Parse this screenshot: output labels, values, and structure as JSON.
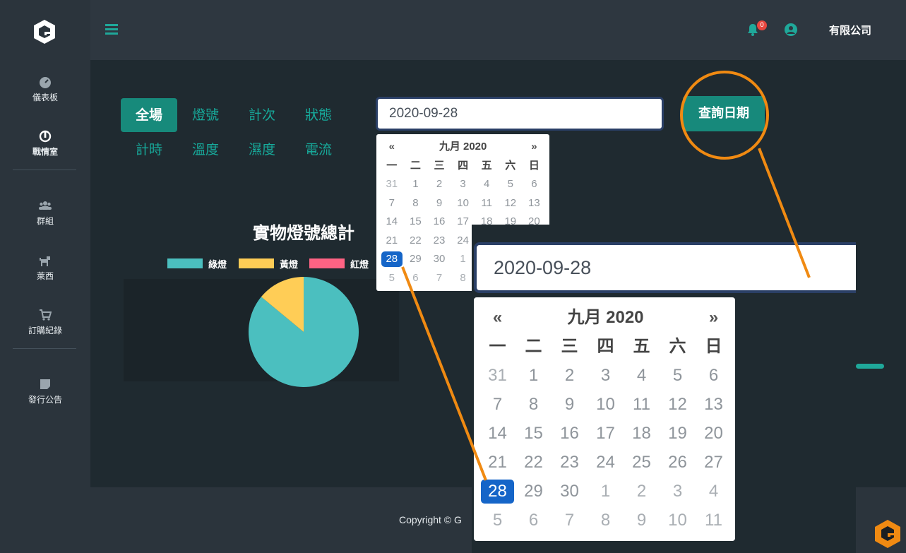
{
  "sidebar": {
    "items": [
      {
        "label": "儀表板",
        "icon": "dashboard-icon"
      },
      {
        "label": "戰情室",
        "icon": "rebel-icon"
      },
      {
        "label": "群組",
        "icon": "users-icon"
      },
      {
        "label": "萊西",
        "icon": "dog-icon"
      },
      {
        "label": "訂購紀錄",
        "icon": "cart-icon"
      },
      {
        "label": "發行公告",
        "icon": "note-icon"
      }
    ]
  },
  "topbar": {
    "notification_count": "0",
    "company": "有限公司"
  },
  "tabs": {
    "row1": [
      "全場",
      "燈號",
      "計次",
      "狀態"
    ],
    "row2": [
      "計時",
      "溫度",
      "濕度",
      "電流"
    ]
  },
  "date_input": {
    "value": "2020-09-28"
  },
  "query_button": {
    "label": "查詢日期"
  },
  "calendar": {
    "prev": "«",
    "next": "»",
    "title": "九月 2020",
    "weekdays": [
      "一",
      "二",
      "三",
      "四",
      "五",
      "六",
      "日"
    ],
    "weeks": [
      [
        "31",
        "1",
        "2",
        "3",
        "4",
        "5",
        "6"
      ],
      [
        "7",
        "8",
        "9",
        "10",
        "11",
        "12",
        "13"
      ],
      [
        "14",
        "15",
        "16",
        "17",
        "18",
        "19",
        "20"
      ],
      [
        "21",
        "22",
        "23",
        "24",
        "25",
        "26",
        "27"
      ],
      [
        "28",
        "29",
        "30",
        "1",
        "2",
        "3",
        "4"
      ],
      [
        "5",
        "6",
        "7",
        "8",
        "9",
        "10",
        "11"
      ]
    ],
    "selected": "28"
  },
  "chart": {
    "title": "實物燈號總計",
    "legend": [
      {
        "label": "綠燈",
        "color": "#4bbfbf"
      },
      {
        "label": "黃燈",
        "color": "#ffcd56"
      },
      {
        "label": "紅燈",
        "color": "#ff6384"
      }
    ]
  },
  "chart_data": {
    "type": "pie",
    "title": "實物燈號總計",
    "categories": [
      "綠燈",
      "黃燈",
      "紅燈"
    ],
    "values": [
      86,
      14,
      0
    ],
    "colors": [
      "#4bbfbf",
      "#ffcd56",
      "#ff6384"
    ]
  },
  "footer": {
    "copyright": "Copyright © G"
  },
  "colors": {
    "accent": "#17897b",
    "highlight": "#f08a12",
    "selected": "#1565c8"
  }
}
